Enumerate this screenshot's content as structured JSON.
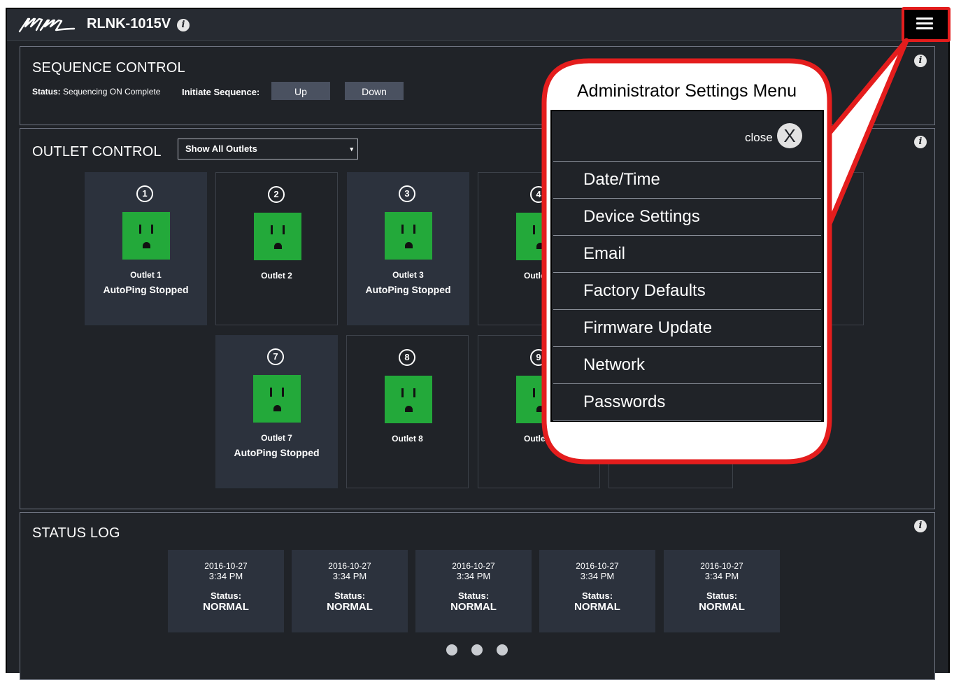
{
  "header": {
    "model": "RLNK-1015V",
    "info_glyph": "i",
    "menu_icon": "hamburger-icon"
  },
  "sequence": {
    "title": "SEQUENCE CONTROL",
    "status_label": "Status:",
    "status_value": "Sequencing ON Complete",
    "initiate_label": "Initiate Sequence:",
    "up_label": "Up",
    "down_label": "Down"
  },
  "outlets": {
    "title": "OUTLET CONTROL",
    "filter_value": "Show All Outlets",
    "caret": "▾",
    "tiles": [
      {
        "num": "1",
        "name": "Outlet 1",
        "status": "AutoPing Stopped"
      },
      {
        "num": "2",
        "name": "Outlet 2",
        "status": ""
      },
      {
        "num": "3",
        "name": "Outlet 3",
        "status": "AutoPing Stopped"
      },
      {
        "num": "4",
        "name": "Outle",
        "status": ""
      },
      {
        "num": "7",
        "name": "Outlet 7",
        "status": "AutoPing Stopped"
      },
      {
        "num": "8",
        "name": "Outlet 8",
        "status": ""
      },
      {
        "num": "9",
        "name": "Outlet",
        "status": ""
      }
    ]
  },
  "status_log": {
    "title": "STATUS LOG",
    "entries": [
      {
        "date": "2016-10-27",
        "time": "3:34 PM",
        "status_label": "Status:",
        "status": "NORMAL"
      },
      {
        "date": "2016-10-27",
        "time": "3:34 PM",
        "status_label": "Status:",
        "status": "NORMAL"
      },
      {
        "date": "2016-10-27",
        "time": "3:34 PM",
        "status_label": "Status:",
        "status": "NORMAL"
      },
      {
        "date": "2016-10-27",
        "time": "3:34 PM",
        "status_label": "Status:",
        "status": "NORMAL"
      },
      {
        "date": "2016-10-27",
        "time": "3:34 PM",
        "status_label": "Status:",
        "status": "NORMAL"
      }
    ]
  },
  "callout": {
    "title": "Administrator Settings Menu",
    "close_label": "close",
    "close_glyph": "X",
    "items": [
      "Date/Time",
      "Device Settings",
      "Email",
      "Factory Defaults",
      "Firmware Update",
      "Network",
      "Passwords"
    ]
  },
  "colors": {
    "background": "#202328",
    "tile": "#2c323d",
    "outlet_on": "#23a93a",
    "button": "#4a5160",
    "callout_border": "#e41d1d"
  }
}
